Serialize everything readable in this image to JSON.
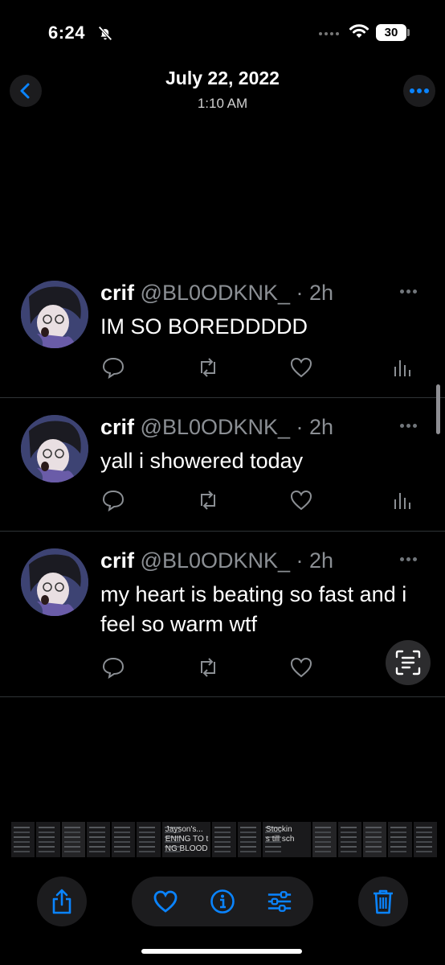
{
  "status_bar": {
    "time": "6:24",
    "battery": "30"
  },
  "header": {
    "title": "July 22, 2022",
    "subtitle": "1:10 AM"
  },
  "tweets": [
    {
      "name": "crif",
      "handle": "@BL0ODKNK_ · 2h",
      "text": "IM SO BOREDDDDD"
    },
    {
      "name": "crif",
      "handle": "@BL0ODKNK_ · 2h",
      "text": "yall i showered today"
    },
    {
      "name": "crif",
      "handle": "@BL0ODKNK_ · 2h",
      "text": "my heart is beating so fast and i feel so warm wtf"
    }
  ],
  "thumbnails": [
    "",
    "",
    "",
    "",
    "",
    "",
    "Jayson's...\nENING TO t\nNG BLOOD\n",
    "",
    "",
    "Stockin\ns till sch",
    "",
    "",
    "",
    "",
    ""
  ],
  "colors": {
    "accent": "#1d9bf0",
    "ios_blue": "#0a84ff",
    "background": "#000000"
  },
  "icons": [
    "back-icon",
    "more-icon",
    "reply-icon",
    "retweet-icon",
    "like-icon",
    "analytics-icon",
    "live-text-icon",
    "share-icon",
    "heart-icon",
    "info-icon",
    "adjust-icon",
    "trash-icon"
  ]
}
